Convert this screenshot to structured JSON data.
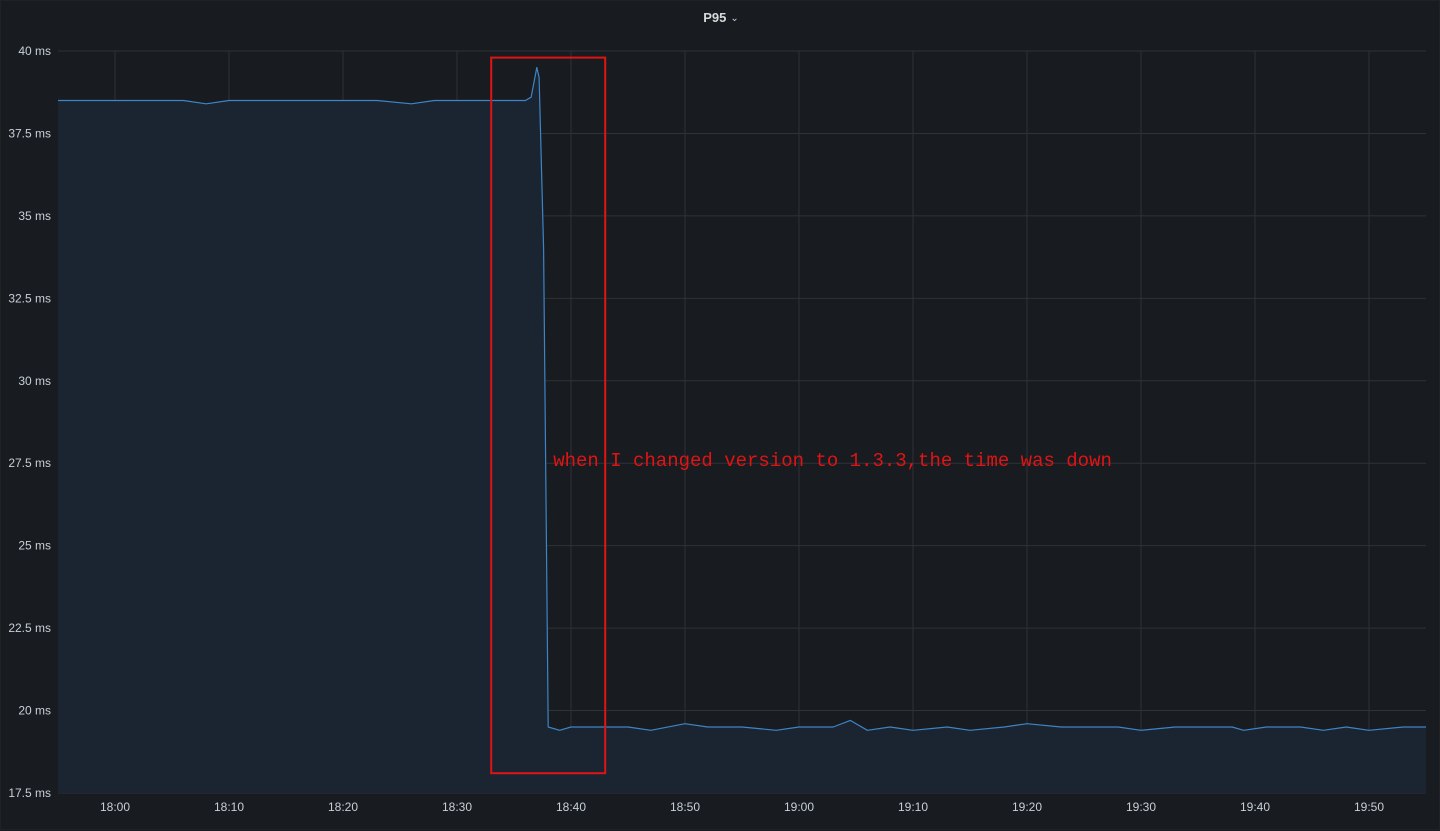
{
  "panel": {
    "title": "P95",
    "title_icon": "chevron-down-icon"
  },
  "colors": {
    "background": "#181b1f",
    "grid": "#2f3238",
    "series_line": "#3d85c6",
    "series_fill": "#1b2431",
    "annotation": "#e01414",
    "tick_text": "#c7d0d9"
  },
  "chart_data": {
    "type": "area",
    "title": "P95",
    "xlabel": "",
    "ylabel": "",
    "y_unit": "ms",
    "x_range": [
      "17:55",
      "19:55"
    ],
    "ylim": [
      17.5,
      40
    ],
    "y_ticks": [
      17.5,
      20,
      22.5,
      25,
      27.5,
      30,
      32.5,
      35,
      37.5,
      40
    ],
    "y_tick_labels": [
      "17.5 ms",
      "20 ms",
      "22.5 ms",
      "25 ms",
      "27.5 ms",
      "30 ms",
      "32.5 ms",
      "35 ms",
      "37.5 ms",
      "40 ms"
    ],
    "x_ticks": [
      "18:00",
      "18:10",
      "18:20",
      "18:30",
      "18:40",
      "18:50",
      "19:00",
      "19:10",
      "19:20",
      "19:30",
      "19:40",
      "19:50"
    ],
    "grid": true,
    "legend": "none",
    "series": [
      {
        "x": [
          "17:55",
          "17:58",
          "18:00",
          "18:03",
          "18:06",
          "18:08",
          "18:10",
          "18:13",
          "18:16",
          "18:18",
          "18:20",
          "18:23",
          "18:26",
          "18:28",
          "18:30",
          "18:33",
          "18:36",
          "18:36.5",
          "18:37",
          "18:37.2",
          "18:37.6",
          "18:38",
          "18:39",
          "18:40",
          "18:42",
          "18:45",
          "18:47",
          "18:50",
          "18:52",
          "18:55",
          "18:58",
          "19:00",
          "19:03",
          "19:04.5",
          "19:06",
          "19:08",
          "19:10",
          "19:13",
          "19:15",
          "19:18",
          "19:20",
          "19:23",
          "19:25",
          "19:28",
          "19:30",
          "19:33",
          "19:35",
          "19:38",
          "19:39",
          "19:41",
          "19:44",
          "19:46",
          "19:48",
          "19:50",
          "19:53",
          "19:55"
        ],
        "values": [
          38.5,
          38.5,
          38.5,
          38.5,
          38.5,
          38.4,
          38.5,
          38.5,
          38.5,
          38.5,
          38.5,
          38.5,
          38.4,
          38.5,
          38.5,
          38.5,
          38.5,
          38.6,
          39.5,
          39.2,
          34.0,
          19.5,
          19.4,
          19.5,
          19.5,
          19.5,
          19.4,
          19.6,
          19.5,
          19.5,
          19.4,
          19.5,
          19.5,
          19.7,
          19.4,
          19.5,
          19.4,
          19.5,
          19.4,
          19.5,
          19.6,
          19.5,
          19.5,
          19.5,
          19.4,
          19.5,
          19.5,
          19.5,
          19.4,
          19.5,
          19.5,
          19.4,
          19.5,
          19.4,
          19.5,
          19.5
        ]
      }
    ],
    "annotations": [
      {
        "text": "when I changed version to 1.3.3,the time was down",
        "x_range": [
          "18:33",
          "18:43"
        ],
        "y_range": [
          18.1,
          39.8
        ]
      }
    ]
  }
}
